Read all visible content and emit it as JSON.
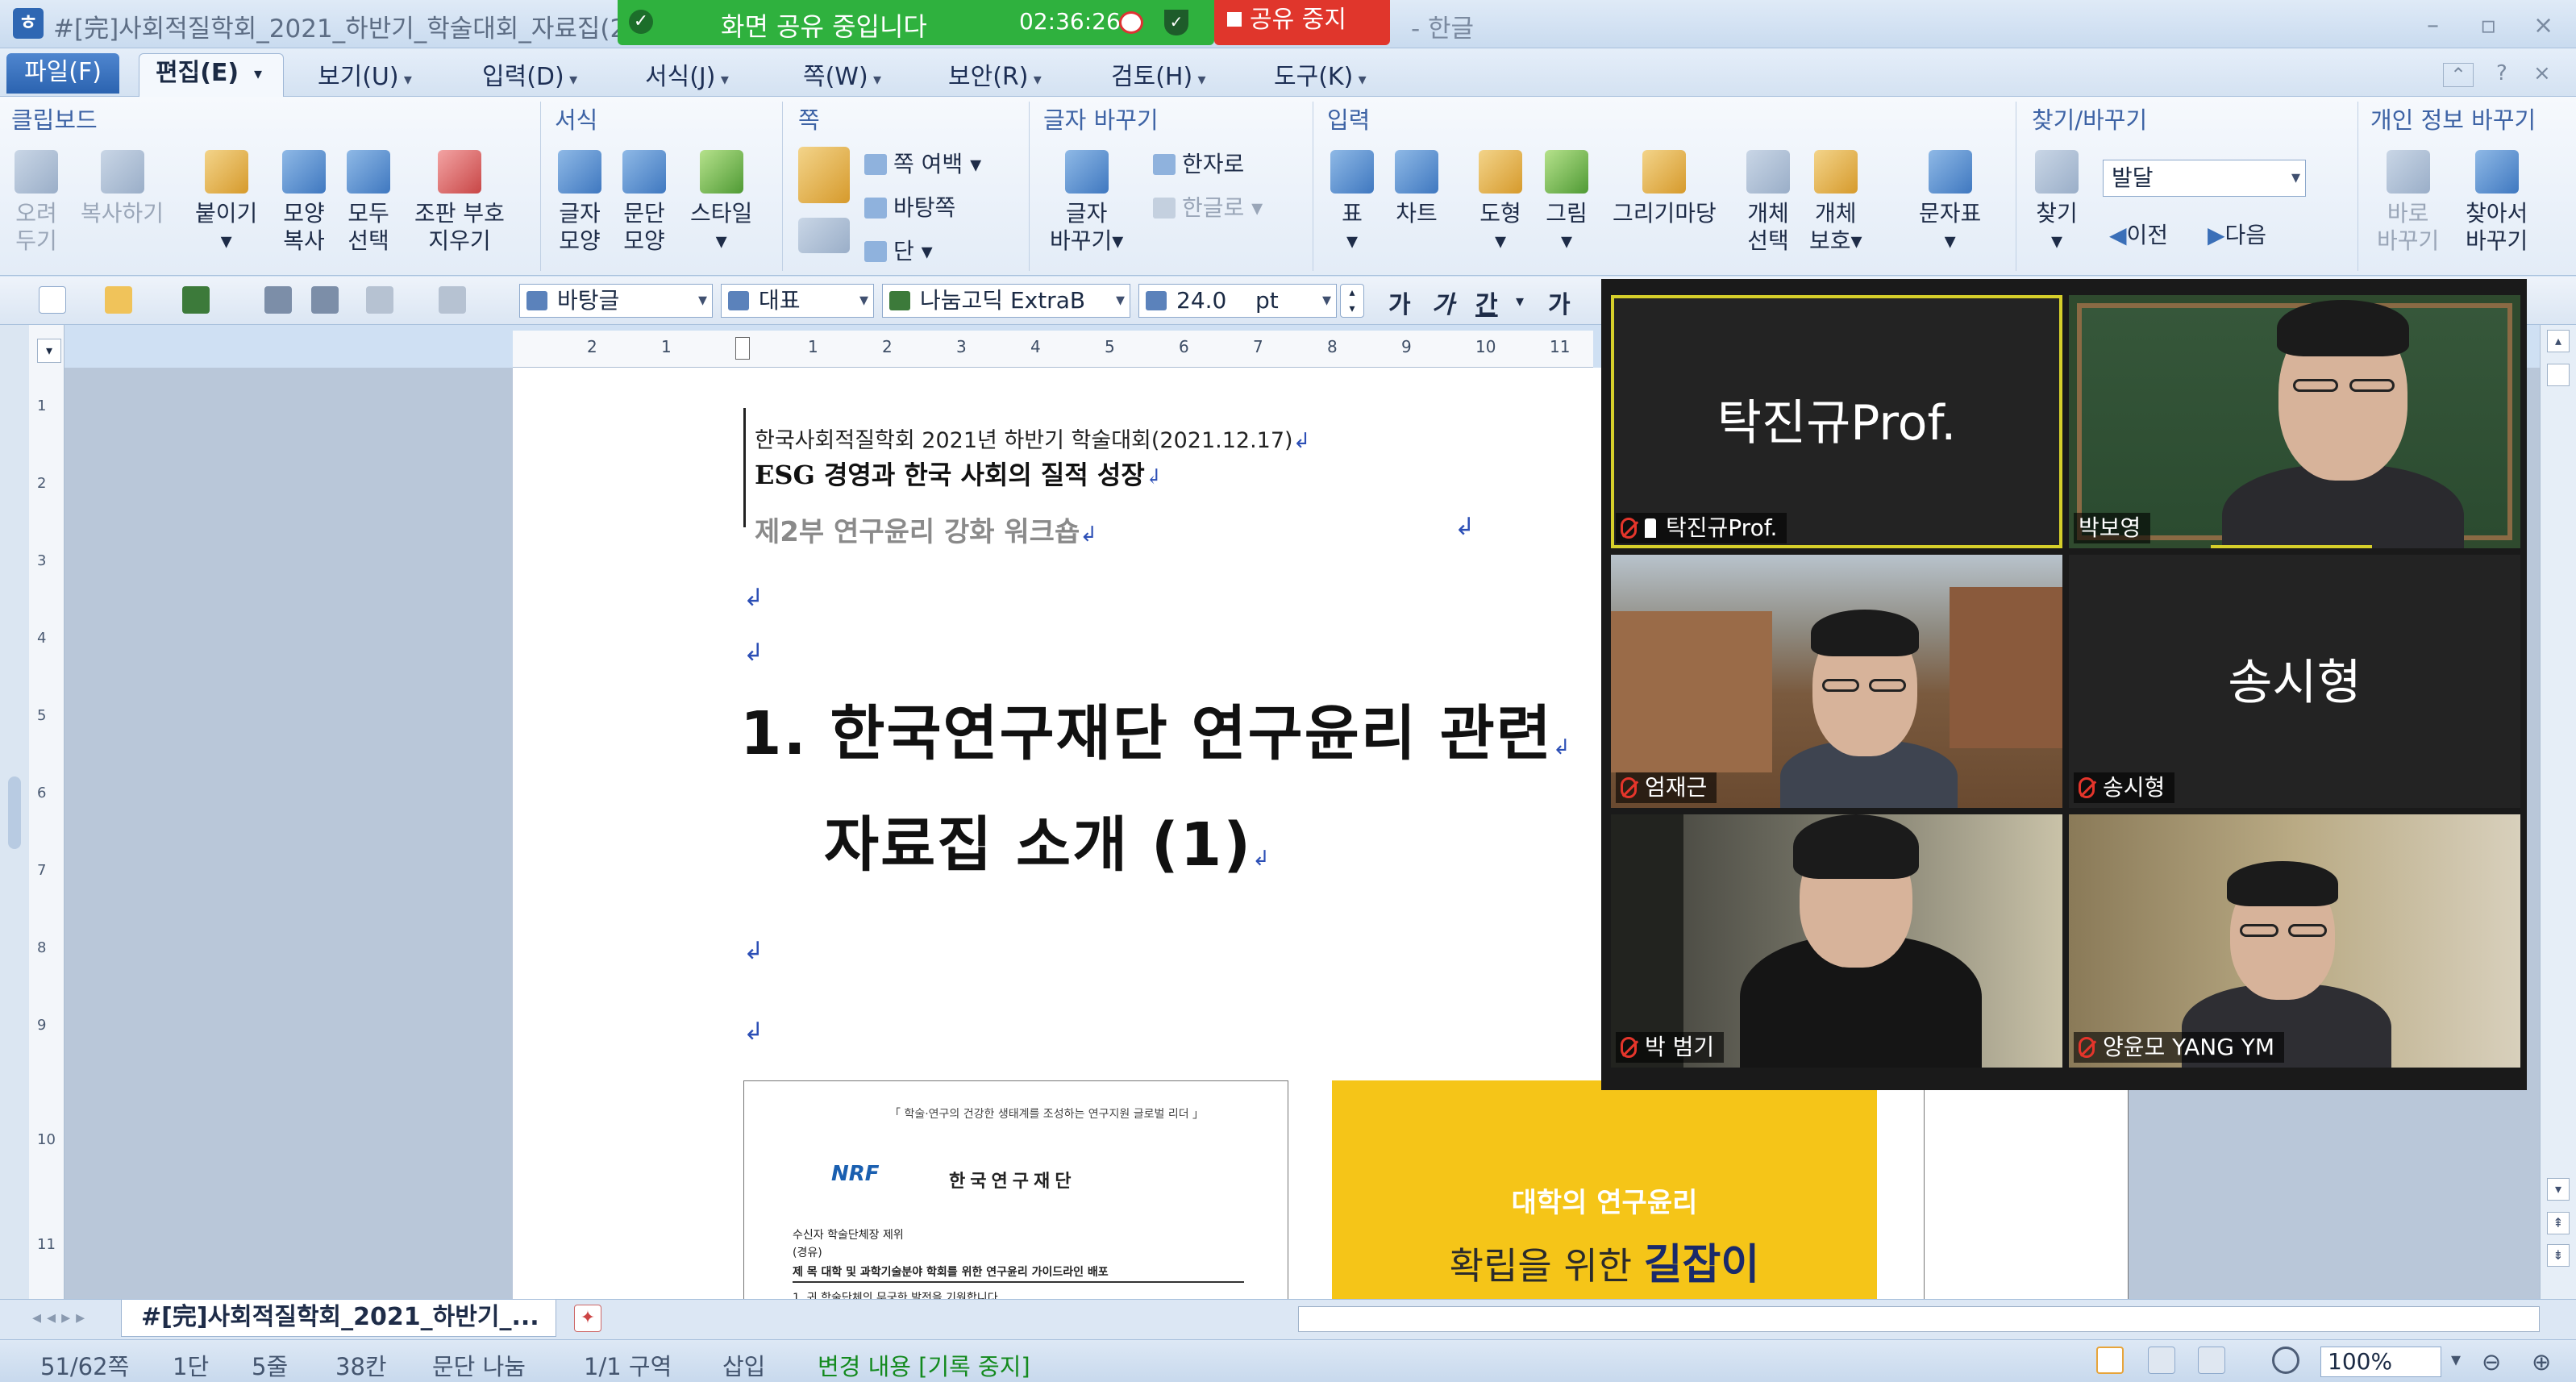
{
  "titlebar": {
    "document_title": "#[完]사회적질학회_2021_하반기_학술대회_자료집(2",
    "app_suffix": "- 한글",
    "window_controls": [
      "–",
      "▫",
      "×"
    ]
  },
  "share_banner": {
    "status": "화면 공유 중입니다",
    "time": "02:36:26",
    "stop_label": "공유 중지"
  },
  "menu": {
    "file": "파일(F)",
    "edit": "편집(E)",
    "items": [
      "보기(U)",
      "입력(D)",
      "서식(J)",
      "쪽(W)",
      "보안(R)",
      "검토(H)",
      "도구(K)"
    ],
    "help": "?"
  },
  "ribbon": {
    "groups": {
      "clipboard": "클립보드",
      "format": "서식",
      "page": "쪽",
      "replace_char": "글자 바꾸기",
      "insert": "입력",
      "find_replace": "찾기/바꾸기",
      "privacy": "개인 정보 바꾸기"
    },
    "clipboard": {
      "cut": [
        "오려",
        "두기"
      ],
      "copy": "복사하기",
      "paste": "붙이기",
      "format_copy": [
        "모양",
        "복사"
      ],
      "select_all": [
        "모두",
        "선택"
      ],
      "clear_mark": [
        "조판 부호",
        "지우기"
      ]
    },
    "format": {
      "char_shape": [
        "글자",
        "모양"
      ],
      "para_shape": [
        "문단",
        "모양"
      ],
      "style": "스타일"
    },
    "page": {
      "margin": "쪽 여백",
      "background": "바탕쪽",
      "column": "단"
    },
    "replace_char": {
      "change": [
        "글자",
        "바꾸기"
      ],
      "hanja": "한자로",
      "hangul": "한글로"
    },
    "insert": {
      "table": "표",
      "chart": "차트",
      "shape": "도형",
      "picture": "그림",
      "draw": "그리기마당",
      "obj_select": [
        "개체",
        "선택"
      ],
      "obj_protect": [
        "개체",
        "보호"
      ],
      "symbols": "문자표"
    },
    "find": {
      "find": "찾기",
      "input_value": "발달",
      "prev": "이전",
      "next": "다음"
    },
    "privacy": {
      "direct_change": [
        "바로",
        "바꾸기"
      ],
      "find_change": [
        "찾아서",
        "바꾸기"
      ]
    }
  },
  "format_toolbar": {
    "style": "바탕글",
    "lang": "대표",
    "font": "나눔고딕 ExtraB",
    "size": "24.0",
    "unit": "pt",
    "bold": "가",
    "italic": "가",
    "underline": "간",
    "strike": "가"
  },
  "ruler": {
    "h_ticks": [
      "2",
      "1",
      "1",
      "2",
      "3",
      "4",
      "5",
      "6",
      "7",
      "8",
      "9",
      "10",
      "11"
    ],
    "v_ticks": [
      "1",
      "2",
      "3",
      "4",
      "5",
      "6",
      "7",
      "8",
      "9",
      "10",
      "11"
    ]
  },
  "document": {
    "header_line1": "한국사회적질학회 2021년 하반기 학술대회(2021.12.17)",
    "header_line2": "ESG 경영과 한국 사회의 질적 성장",
    "header_line3": "제2부 연구윤리 강화 워크숍",
    "heading_line1": "1.  한국연구재단  연구윤리  관련",
    "heading_line2": "자료집  소개  (1)",
    "return_mark": "↲"
  },
  "embedded_images": {
    "nrf_doc": {
      "slogan": "「 학술·연구의 건강한 생태계를 조성하는 연구지원 글로벌 리더 」",
      "logo": "NRF",
      "org": "한국연구재단",
      "row1": "수신자   학술단체장 제위",
      "row2": "(경유)",
      "row3": "제  목   대학 및 과학기술분야 학회를 위한 연구윤리 가이드라인 배포",
      "row4": "1. 귀 학술단체의 무궁한 발전을 기원합니다."
    },
    "guide_cover": {
      "line1": "대학의 연구윤리",
      "line2_pre": "확립을 위한",
      "line2_bold": "길잡이"
    }
  },
  "tabs": {
    "doc_tab": "#[完]사회적질학회_2021_하반기_..."
  },
  "status": {
    "page": "51/62쪽",
    "column": "1단",
    "line": "5줄",
    "col": "38칸",
    "break": "문단 나눔",
    "section": "1/1 구역",
    "insert": "삽입",
    "track": "변경 내용 [기록 중지]",
    "zoom": "100%"
  },
  "gallery": {
    "participants": [
      {
        "name": "탁진규Prof.",
        "display": "탁진규Prof.",
        "video": false,
        "pinned": true,
        "active": true
      },
      {
        "name": "박보영",
        "video": true
      },
      {
        "name": "엄재근",
        "video": true
      },
      {
        "name": "송시형",
        "display": "송시형",
        "video": false
      },
      {
        "name": "박 범기",
        "video": true
      },
      {
        "name": "양윤모 YANG YM",
        "video": true
      }
    ]
  }
}
